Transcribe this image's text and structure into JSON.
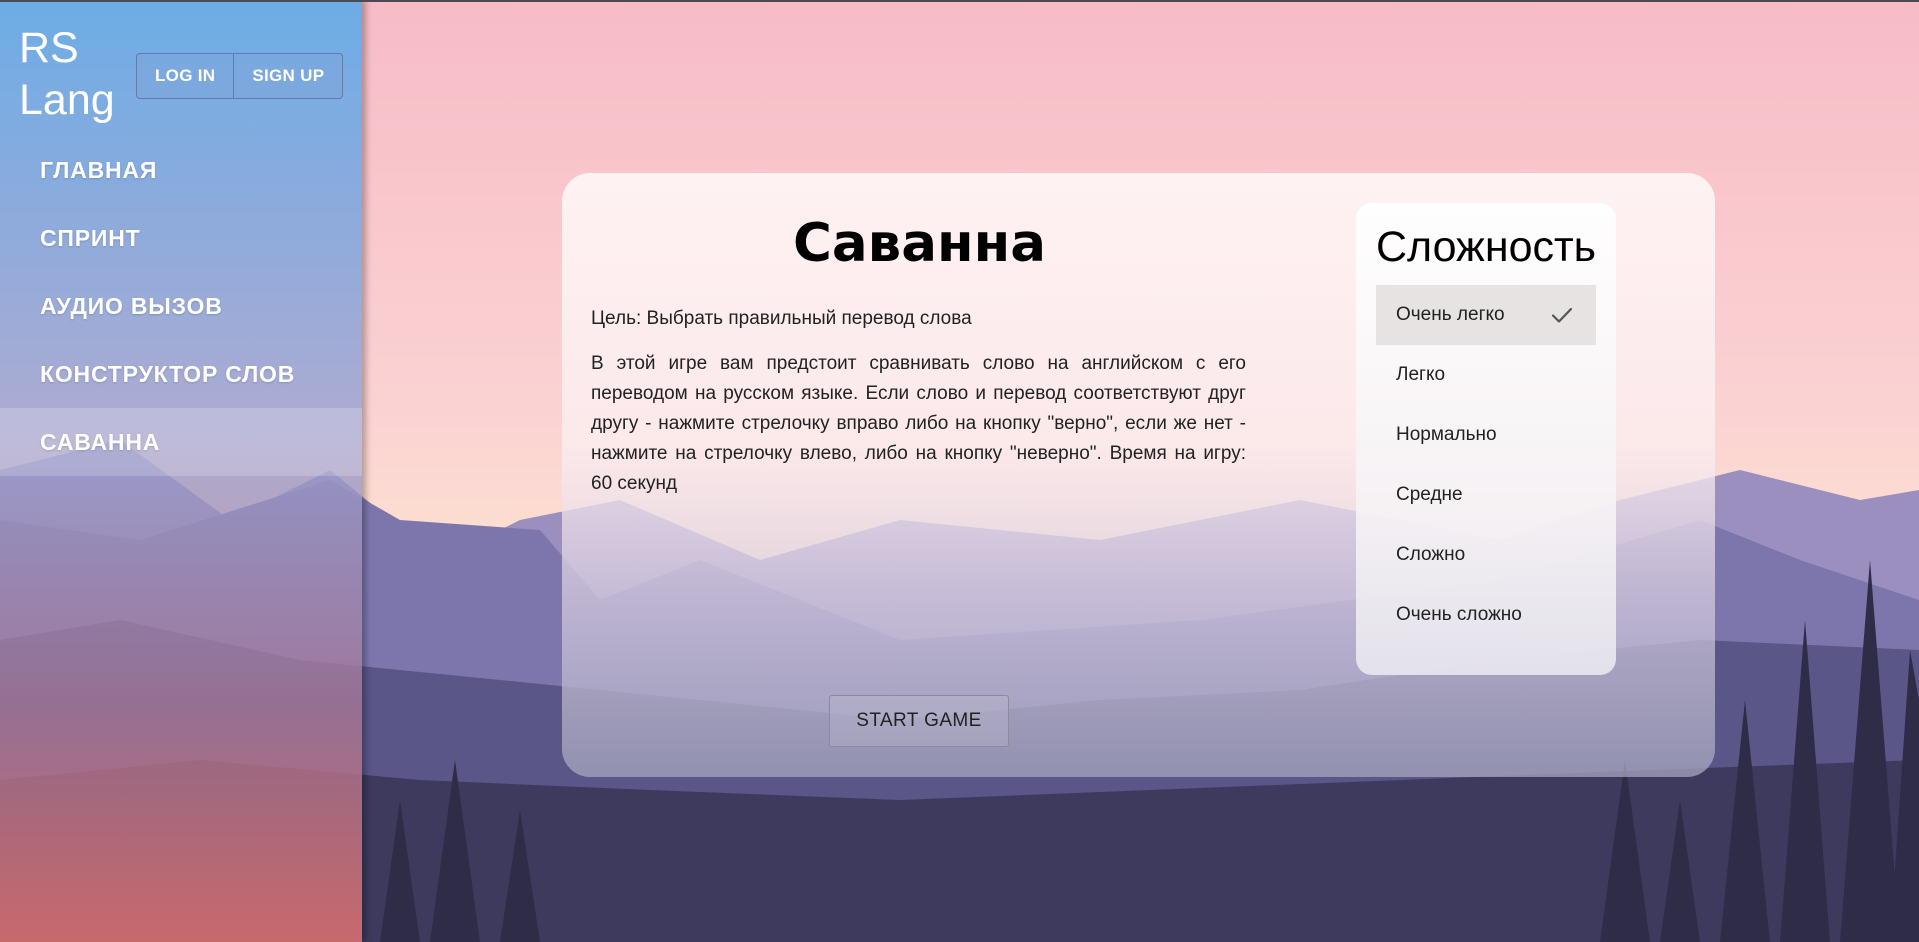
{
  "brand": {
    "line1": "RS",
    "line2": "Lang"
  },
  "auth": {
    "login": "LOG IN",
    "signup": "SIGN UP"
  },
  "nav": {
    "items": [
      {
        "label": "ГЛАВНАЯ"
      },
      {
        "label": "СПРИНТ"
      },
      {
        "label": "АУДИО ВЫЗОВ"
      },
      {
        "label": "КОНСТРУКТОР СЛОВ"
      },
      {
        "label": "САВАННА"
      }
    ],
    "active": "САВАННА"
  },
  "game": {
    "title": "Саванна",
    "goal": "Цель: Выбрать правильный перевод слова",
    "description": "В этой игре вам предстоит сравнивать слово на английском с его переводом на русском языке. Если слово и перевод соответствуют друг другу - нажмите стрелочку вправо либо на кнопку \"верно\", если же нет - нажмите на стрелочку влево, либо на кнопку \"неверно\". Время на игру: 60 секунд",
    "start_label": "START GAME"
  },
  "difficulty": {
    "title": "Сложность",
    "options": [
      {
        "label": "Очень легко"
      },
      {
        "label": "Легко"
      },
      {
        "label": "Нормально"
      },
      {
        "label": "Средне"
      },
      {
        "label": "Сложно"
      },
      {
        "label": "Очень сложно"
      }
    ],
    "selected": "Очень легко"
  },
  "icons": {
    "checkmark": "check-icon"
  },
  "colors": {
    "sidebar_top": "#5aaaeb",
    "sidebar_bottom": "#d76e6e",
    "sky": "#f6c3c8",
    "selected_option": "#e6e3e2"
  }
}
